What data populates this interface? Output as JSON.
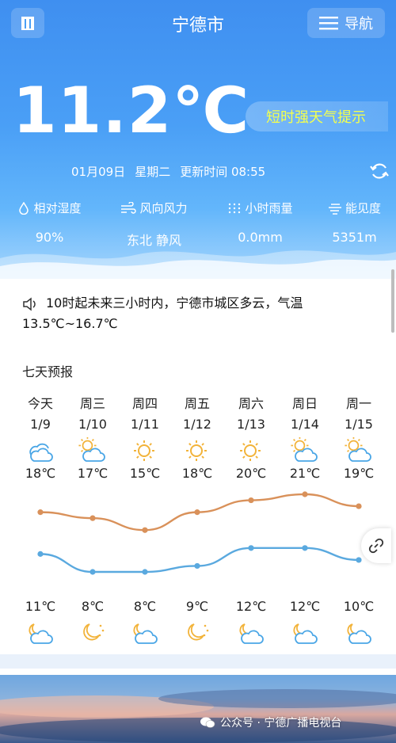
{
  "header": {
    "city": "宁德市",
    "nav_label": "导航"
  },
  "current": {
    "temperature": "11.2℃",
    "alert": "短时强天气提示",
    "date": "01月09日",
    "weekday": "星期二",
    "update_time": "更新时间 08:55"
  },
  "stats": [
    {
      "label": "相对湿度",
      "value": "90%",
      "icon": "water-drop-icon"
    },
    {
      "label": "风向风力",
      "value": "东北 静风",
      "icon": "wind-icon"
    },
    {
      "label": "小时雨量",
      "value": "0.0mm",
      "icon": "rain-icon"
    },
    {
      "label": "能见度",
      "value": "5351m",
      "icon": "visibility-icon"
    }
  ],
  "notice": "10时起未来三小时内，宁德市城区多云，气温13.5℃~16.7℃",
  "forecast_title": "七天预报",
  "forecast": [
    {
      "day": "今天",
      "date": "1/9",
      "high": "18℃",
      "low": "11℃",
      "day_icon": "partly-cloudy-icon",
      "night_icon": "moon-cloud-icon"
    },
    {
      "day": "周三",
      "date": "1/10",
      "high": "17℃",
      "low": "8℃",
      "day_icon": "sun-cloud-icon",
      "night_icon": "moon-stars-icon"
    },
    {
      "day": "周四",
      "date": "1/11",
      "high": "15℃",
      "low": "8℃",
      "day_icon": "sunny-icon",
      "night_icon": "moon-cloud-icon"
    },
    {
      "day": "周五",
      "date": "1/12",
      "high": "18℃",
      "low": "9℃",
      "day_icon": "sunny-icon",
      "night_icon": "moon-stars-icon"
    },
    {
      "day": "周六",
      "date": "1/13",
      "high": "20℃",
      "low": "12℃",
      "day_icon": "sunny-icon",
      "night_icon": "moon-cloud-icon"
    },
    {
      "day": "周日",
      "date": "1/14",
      "high": "21℃",
      "low": "12℃",
      "day_icon": "sun-cloud-icon",
      "night_icon": "moon-cloud-icon"
    },
    {
      "day": "周一",
      "date": "1/15",
      "high": "19℃",
      "low": "10℃",
      "day_icon": "sun-cloud-icon",
      "night_icon": "moon-cloud-icon"
    }
  ],
  "chart_data": {
    "type": "line",
    "categories": [
      "1/9",
      "1/10",
      "1/11",
      "1/12",
      "1/13",
      "1/14",
      "1/15"
    ],
    "series": [
      {
        "values": [
          18,
          17,
          15,
          18,
          20,
          21,
          19
        ],
        "color": "#d9915a"
      },
      {
        "values": [
          11,
          8,
          8,
          9,
          12,
          12,
          10
        ],
        "color": "#5aa9df"
      }
    ]
  },
  "footer": {
    "watermark": "公众号 · 宁德广播电视台"
  },
  "colors": {
    "accent": "#4a9ff6",
    "alert_text": "#f3ff4e"
  }
}
